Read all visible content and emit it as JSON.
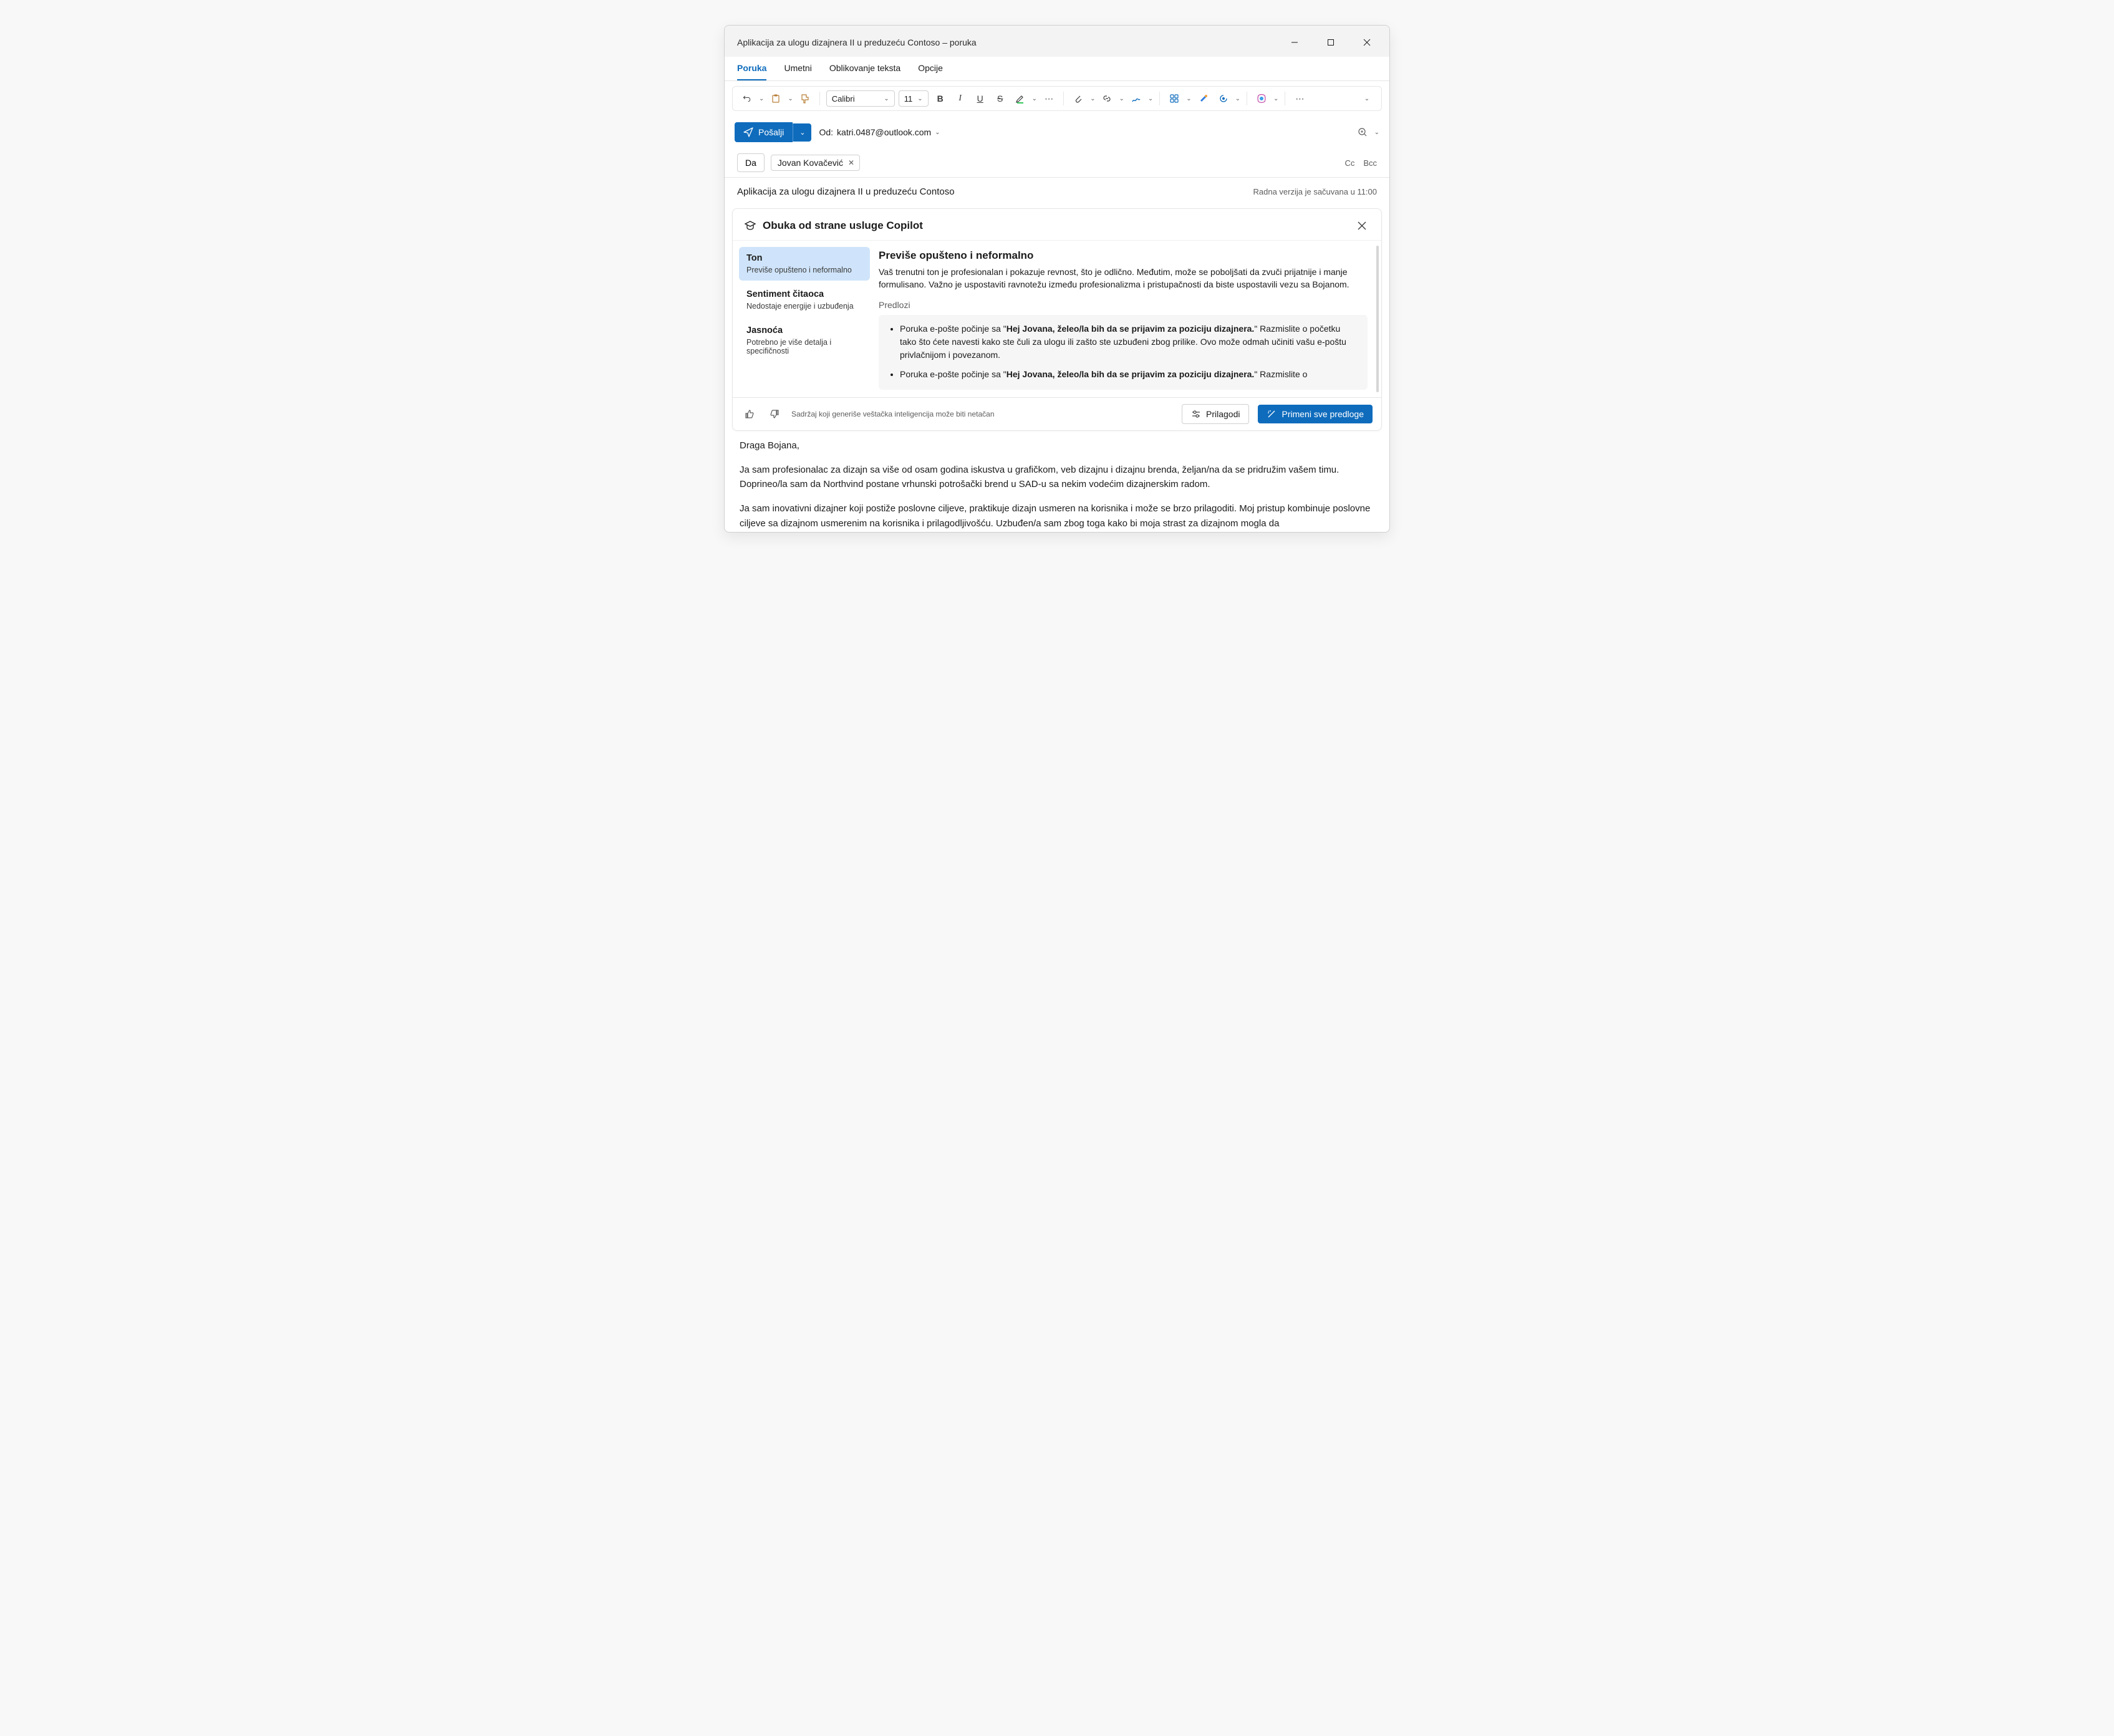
{
  "window": {
    "title": "Aplikacija za ulogu dizajnera II u preduzeću Contoso – poruka"
  },
  "tabs": {
    "message": "Poruka",
    "insert": "Umetni",
    "format": "Oblikovanje teksta",
    "options": "Opcije"
  },
  "ribbon": {
    "font": "Calibri",
    "size": "11"
  },
  "send": {
    "label": "Pošalji",
    "from_label": "Od:",
    "from_email": "katri.0487@outlook.com"
  },
  "to": {
    "label": "Da",
    "recipient": "Jovan Kovačević",
    "cc": "Cc",
    "bcc": "Bcc"
  },
  "subject": "Aplikacija za ulogu dizajnera II u preduzeću Contoso",
  "saved": "Radna verzija je sačuvana u 11:00",
  "copilot": {
    "heading": "Obuka od strane usluge Copilot",
    "side": {
      "tone": {
        "h": "Ton",
        "s": "Previše opušteno i neformalno"
      },
      "sentiment": {
        "h": "Sentiment čitaoca",
        "s": "Nedostaje energije i uzbuđenja"
      },
      "clarity": {
        "h": "Jasnoća",
        "s": "Potrebno je više detalja i specifičnosti"
      }
    },
    "main": {
      "heading": "Previše opušteno i neformalno",
      "body": "Vaš trenutni ton je profesionalan i pokazuje revnost, što je odlično. Međutim, može se poboljšati da zvuči prijatnije i manje formulisano. Važno je uspostaviti ravnotežu između profesionalizma i pristupačnosti da biste uspostavili vezu sa Bojanom.",
      "suggestions_label": "Predlozi",
      "sug1_pre": "Poruka e-pošte počinje sa \"",
      "sug1_bold": "Hej Jovana, želeo/la bih da se prijavim za poziciju dizajnera.",
      "sug1_post": "\" Razmislite o početku tako što ćete navesti kako ste čuli za ulogu ili zašto ste uzbuđeni zbog prilike. Ovo može odmah učiniti vašu e-poštu privlačnijom i povezanom.",
      "sug2_pre": "Poruka e-pošte počinje sa \"",
      "sug2_bold": "Hej Jovana, želeo/la bih da se prijavim za poziciju dizajnera.",
      "sug2_post": "\" Razmislite o"
    },
    "footer": {
      "ai_note": "Sadržaj koji generiše veštačka inteligencija može biti netačan",
      "customize": "Prilagodi",
      "apply_all": "Primeni sve predloge"
    }
  },
  "email_body": {
    "greeting": "Draga Bojana,",
    "p1": "Ja sam profesionalac za dizajn sa više od osam godina iskustva u grafičkom, veb dizajnu i dizajnu brenda, željan/na da se pridružim vašem timu. Doprineo/la sam da Northvind postane vrhunski potrošački brend u SAD-u sa nekim vodećim dizajnerskim radom.",
    "p2": "Ja sam inovativni dizajner koji postiže poslovne ciljeve, praktikuje dizajn usmeren na korisnika i može se brzo prilagoditi. Moj pristup kombinuje poslovne ciljeve sa dizajnom usmerenim na korisnika i prilagodljivošću. Uzbuđen/a sam zbog toga kako bi moja strast za dizajnom mogla da"
  }
}
